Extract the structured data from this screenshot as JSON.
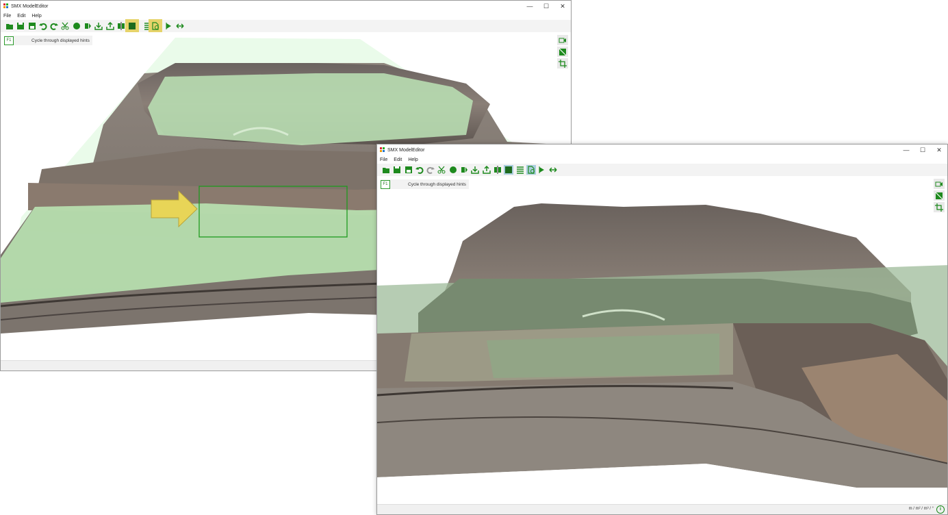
{
  "windows": [
    {
      "title": "SMX ModelEditor",
      "menu": [
        "File",
        "Edit",
        "Help"
      ],
      "hint": {
        "key": "F1",
        "text": "Cycle through displayed hints"
      },
      "highlighted_tools": [
        "plane-select-tool",
        "rotate-model-tool"
      ]
    },
    {
      "title": "SMX ModelEditor",
      "menu": [
        "File",
        "Edit",
        "Help"
      ],
      "hint": {
        "key": "F1",
        "text": "Cycle through displayed hints"
      },
      "status": {
        "units": "m / m² / m³ / °"
      },
      "active_tools": [
        "plane-select-tool",
        "list-tool",
        "rotate-model-tool"
      ]
    }
  ],
  "window_controls": {
    "minimize": "—",
    "maximize": "☐",
    "close": "✕"
  },
  "icons": [
    "open-folder-icon",
    "save-icon",
    "save-as-icon",
    "undo-icon",
    "redo-icon",
    "cut-icon",
    "sphere-icon",
    "mirror-icon",
    "import-icon",
    "export-icon",
    "align-icon",
    "plane-icon",
    "list-icon",
    "rotate-model-icon",
    "arrow-right-icon",
    "double-arrow-icon",
    "camera-icon",
    "section-icon",
    "crop-icon",
    "info-icon"
  ],
  "colors": {
    "accent": "#1e8a1e",
    "highlight": "#e6d36a",
    "active": "#a9cdde",
    "overlay": "#b9e8b9",
    "annotation_arrow": "#e8d557",
    "selection_box": "#1e9a1e"
  }
}
